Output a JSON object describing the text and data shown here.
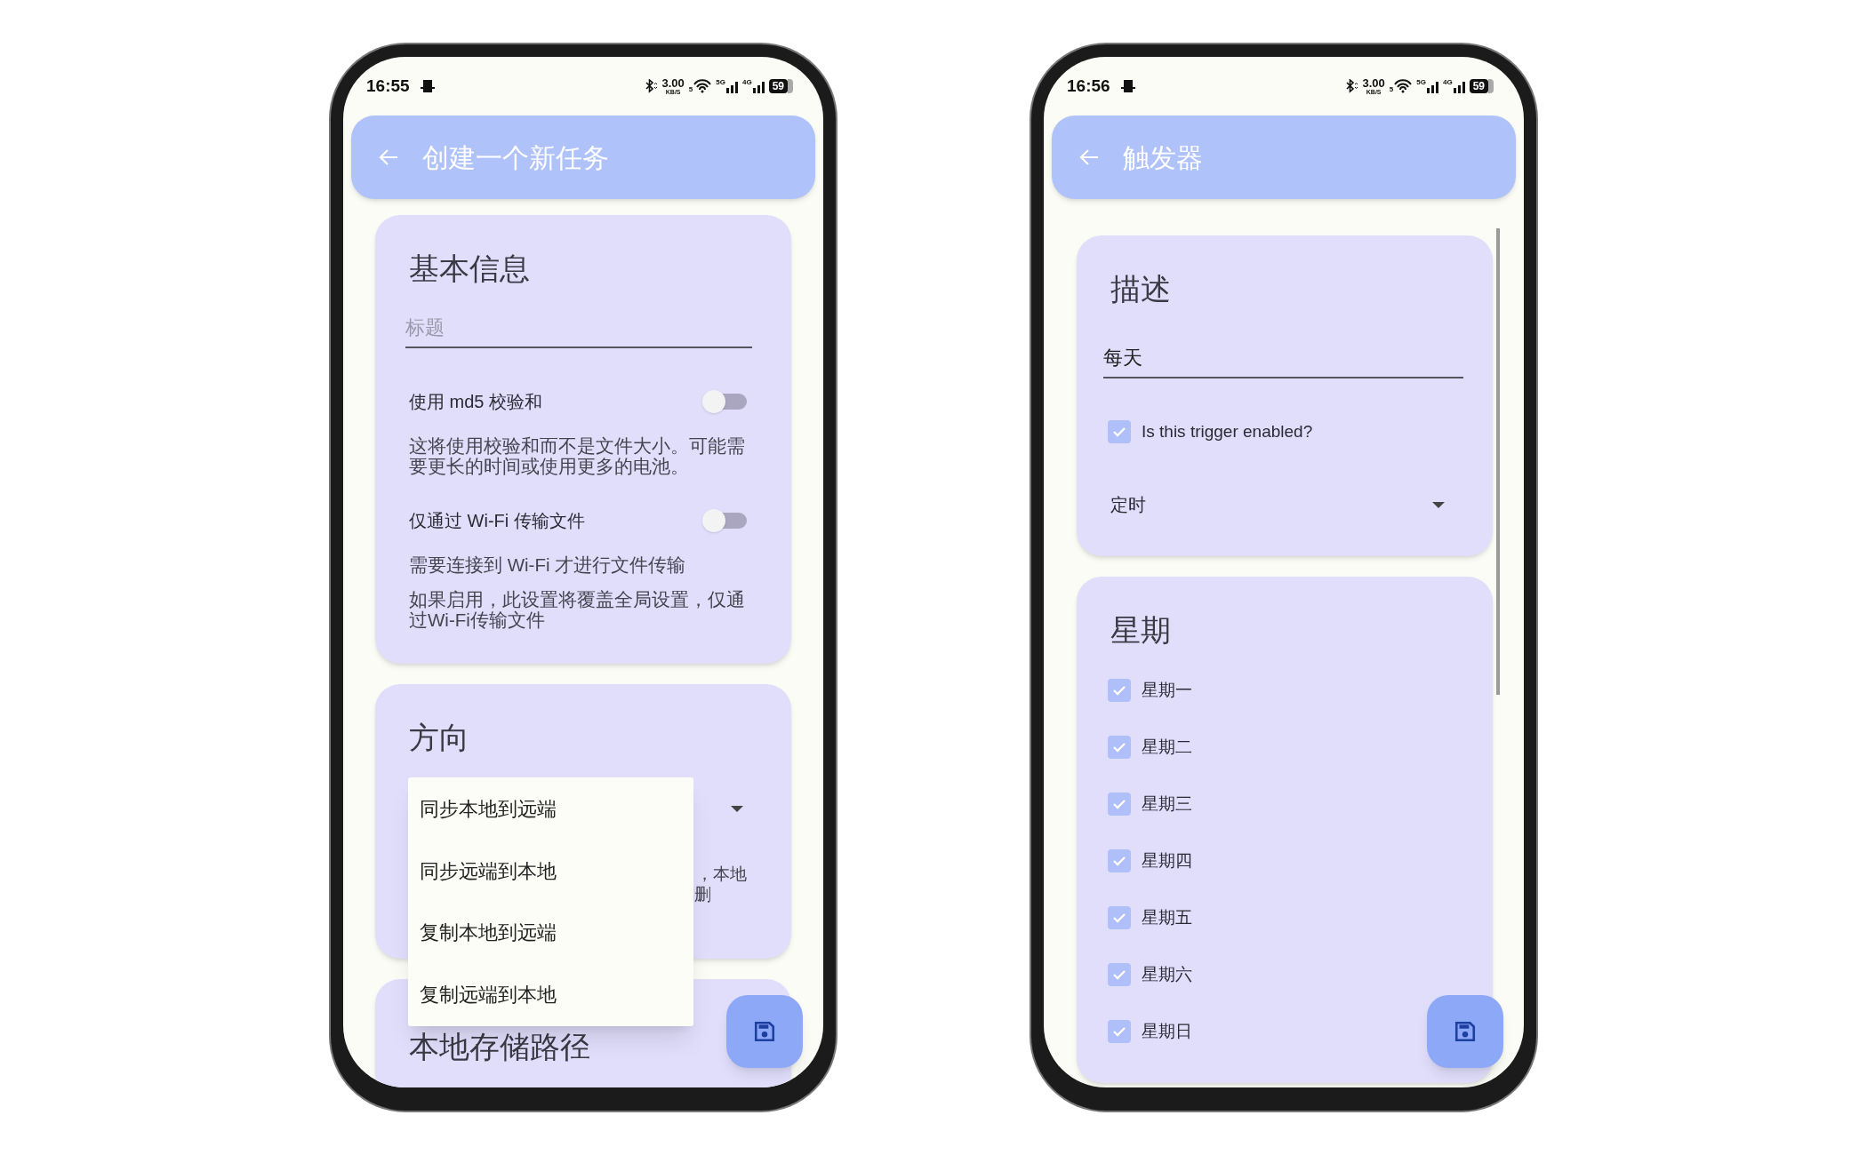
{
  "phones": [
    {
      "status_bar": {
        "time": "16:55",
        "speed": "3.00",
        "speed_unit": "KB/S",
        "wifi_label": "5",
        "signal_1": "5G",
        "signal_2": "4G",
        "battery": "59"
      },
      "app_bar": {
        "title": "创建一个新任务"
      },
      "cards": [
        {
          "title": "基本信息",
          "items": [
            {
              "kind": "field",
              "placeholder": "标题"
            },
            {
              "kind": "toggle",
              "label": "使用 md5 校验和",
              "on": false
            },
            {
              "kind": "note",
              "text": "这将使用校验和而不是文件大小。可能需要更长的时间或使用更多的电池。"
            },
            {
              "kind": "toggle",
              "label": "仅通过 Wi-Fi 传输文件",
              "on": false
            },
            {
              "kind": "note",
              "text": "需要连接到 Wi-Fi 才进行文件传输"
            },
            {
              "kind": "note",
              "text": "如果启用，此设置将覆盖全局设置，仅通过Wi-Fi传输文件"
            }
          ]
        },
        {
          "title": "方向",
          "items": [
            {
              "kind": "select"
            },
            {
              "kind": "fragment",
              "lines": [
                "，本地",
                "删"
              ]
            }
          ]
        },
        {
          "title": "本地存储路径"
        }
      ],
      "menu": {
        "items": [
          {
            "label": "同步本地到远端",
            "selected": false
          },
          {
            "label": "同步远端到本地",
            "selected": false
          },
          {
            "label": "复制本地到远端",
            "selected": false
          },
          {
            "label": "复制远端到本地",
            "selected": false
          }
        ]
      }
    },
    {
      "status_bar": {
        "time": "16:56",
        "speed": "3.00",
        "speed_unit": "KB/S",
        "wifi_label": "5",
        "signal_1": "5G",
        "signal_2": "4G",
        "battery": "59"
      },
      "app_bar": {
        "title": "触发器"
      },
      "scrollbar": true,
      "cards": [
        {
          "title": "描述",
          "items": [
            {
              "kind": "field",
              "value": "每天"
            },
            {
              "kind": "checkbox",
              "label": "Is this trigger enabled?",
              "checked": true
            },
            {
              "kind": "select",
              "value": "定时"
            }
          ]
        },
        {
          "title": "星期",
          "items": [
            {
              "kind": "checkbox",
              "label": "星期一",
              "checked": true
            },
            {
              "kind": "checkbox",
              "label": "星期二",
              "checked": true
            },
            {
              "kind": "checkbox",
              "label": "星期三",
              "checked": true
            },
            {
              "kind": "checkbox",
              "label": "星期四",
              "checked": true
            },
            {
              "kind": "checkbox",
              "label": "星期五",
              "checked": true
            },
            {
              "kind": "checkbox",
              "label": "星期六",
              "checked": true
            },
            {
              "kind": "checkbox",
              "label": "星期日",
              "checked": true
            }
          ]
        }
      ]
    }
  ]
}
